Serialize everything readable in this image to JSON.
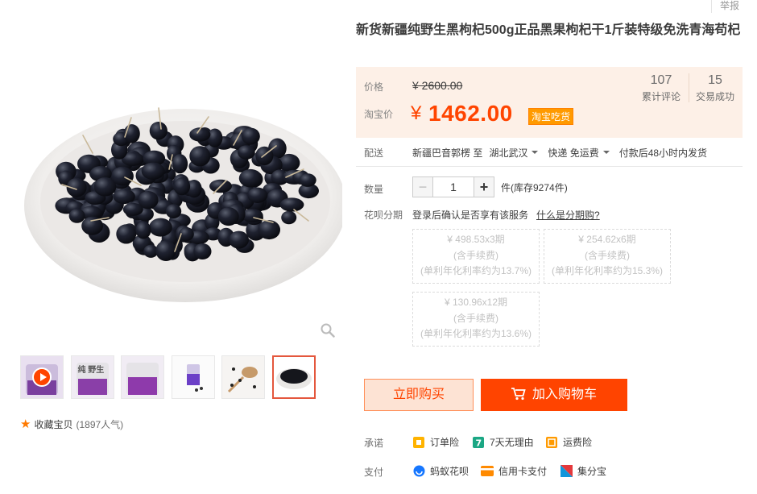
{
  "report_label": "举报",
  "product": {
    "title": "新货新疆纯野生黑枸杞500g正品黑果枸杞干1斤装特级免洗青海苟杞"
  },
  "price": {
    "label": "价格",
    "original": "¥ 2600.00",
    "taobao_label": "淘宝价",
    "currency": "¥",
    "current": "1462.00",
    "badge": "淘宝吃货"
  },
  "stats": {
    "reviews_count": "107",
    "reviews_label": "累计评论",
    "sales_count": "15",
    "sales_label": "交易成功"
  },
  "shipping": {
    "label": "配送",
    "from": "新疆巴音郭楞 至",
    "to": "湖北武汉",
    "method": "快递 免运费",
    "note": "付款后48小时内发货"
  },
  "quantity": {
    "label": "数量",
    "minus": "−",
    "value": "1",
    "plus": "+",
    "stock": "件(库存9274件)"
  },
  "huabei": {
    "label": "花呗分期",
    "text": "登录后确认是否享有该服务",
    "link": "什么是分期购?",
    "plans": [
      {
        "amount": "¥ 498.53x3期",
        "fee": "(含手续费)",
        "rate": "(单利年化利率约为13.7%)"
      },
      {
        "amount": "¥ 254.62x6期",
        "fee": "(含手续费)",
        "rate": "(单利年化利率约为15.3%)"
      },
      {
        "amount": "¥ 130.96x12期",
        "fee": "(含手续费)",
        "rate": "(单利年化利率约为13.6%)"
      }
    ]
  },
  "actions": {
    "buy_now": "立即购买",
    "add_to_cart": "加入购物车"
  },
  "promise": {
    "label": "承诺",
    "items": [
      "订单险",
      "7天无理由",
      "运费险"
    ]
  },
  "payment": {
    "label": "支付",
    "items": [
      "蚂蚁花呗",
      "信用卡支付",
      "集分宝"
    ]
  },
  "favorite": {
    "label": "收藏宝贝",
    "count": "(1897人气)"
  },
  "thumbnails": [
    {
      "icon": "video-thumb",
      "label": ""
    },
    {
      "icon": "jar-thumb",
      "label": "纯 野生"
    },
    {
      "icon": "jar-thumb-2",
      "label": ""
    },
    {
      "icon": "tea-cup-thumb",
      "label": ""
    },
    {
      "icon": "spoon-thumb",
      "label": ""
    },
    {
      "icon": "plate-thumb",
      "label": ""
    }
  ],
  "colors": {
    "accent": "#ff4400",
    "price_bg": "#fdf0e7",
    "badge": "#ff9a00"
  }
}
